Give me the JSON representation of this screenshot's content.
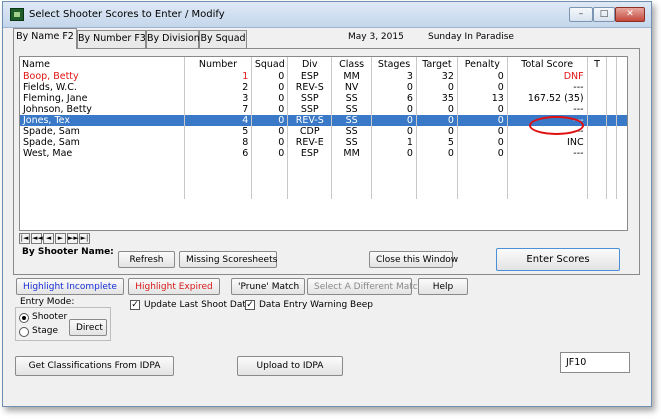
{
  "window": {
    "title": "Select Shooter Scores to Enter / Modify",
    "controls": {
      "minimize": "–",
      "maximize": "□",
      "close": "✕"
    }
  },
  "tabs": [
    {
      "label": "By Name F2",
      "active": true
    },
    {
      "label": "By Number F3",
      "active": false
    },
    {
      "label": "By Division",
      "active": false
    },
    {
      "label": "By Squad",
      "active": false
    }
  ],
  "header_info": {
    "date": "May  3, 2015",
    "match_name": "Sunday In Paradise"
  },
  "grid": {
    "columns": [
      "Name",
      "Number",
      "Squad",
      "Div",
      "Class",
      "Stages",
      "Target",
      "Penalty",
      "Total Score",
      "T"
    ],
    "rows": [
      {
        "name": "Boop, Betty",
        "number": "1",
        "squad": "0",
        "div": "ESP",
        "class": "MM",
        "stages": "3",
        "target": "32",
        "penalty": "0",
        "total": "DNF",
        "t": ""
      },
      {
        "name": "Fields, W.C.",
        "number": "2",
        "squad": "0",
        "div": "REV-S",
        "class": "NV",
        "stages": "0",
        "target": "0",
        "penalty": "0",
        "total": "---",
        "t": ""
      },
      {
        "name": "Fleming, Jane",
        "number": "3",
        "squad": "0",
        "div": "SSP",
        "class": "SS",
        "stages": "6",
        "target": "35",
        "penalty": "13",
        "total": "167.52 (35)",
        "t": ""
      },
      {
        "name": "Johnson, Betty",
        "number": "7",
        "squad": "0",
        "div": "SSP",
        "class": "SS",
        "stages": "0",
        "target": "0",
        "penalty": "0",
        "total": "---",
        "t": ""
      },
      {
        "name": "Jones, Tex",
        "number": "4",
        "squad": "0",
        "div": "REV-S",
        "class": "SS",
        "stages": "0",
        "target": "0",
        "penalty": "0",
        "total": "---",
        "t": ""
      },
      {
        "name": "Spade, Sam",
        "number": "5",
        "squad": "0",
        "div": "CDP",
        "class": "SS",
        "stages": "0",
        "target": "0",
        "penalty": "0",
        "total": "---",
        "t": ""
      },
      {
        "name": "Spade, Sam",
        "number": "8",
        "squad": "0",
        "div": "REV-E",
        "class": "SS",
        "stages": "1",
        "target": "5",
        "penalty": "0",
        "total": "INC",
        "t": ""
      },
      {
        "name": "West, Mae",
        "number": "6",
        "squad": "0",
        "div": "ESP",
        "class": "MM",
        "stages": "0",
        "target": "0",
        "penalty": "0",
        "total": "---",
        "t": ""
      }
    ],
    "nav_glyphs": [
      "|◄",
      "◄◄",
      "◄",
      "►",
      "►►",
      "►|"
    ]
  },
  "panel": {
    "by_shooter_label": "By Shooter Name:",
    "refresh": "Refresh",
    "missing": "Missing Scoresheets",
    "close_window": "Close this Window",
    "enter_scores": "Enter Scores"
  },
  "actions": {
    "highlight_incomplete": "Highlight Incomplete",
    "highlight_expired": "Highlight Expired",
    "prune": "'Prune' Match",
    "select_match": "Select A Different  Match",
    "help": "Help"
  },
  "entry_mode": {
    "label": "Entry Mode:",
    "shooter": "Shooter",
    "stage": "Stage",
    "direct": "Direct"
  },
  "options": {
    "update_last": "Update Last Shoot Date",
    "warning_beep": "Data Entry Warning Beep",
    "check": "✓"
  },
  "bottom": {
    "get_class": "Get Classifications From IDPA",
    "upload": "Upload to IDPA",
    "code": "JF10"
  },
  "colors": {
    "selected": "#3a79c7",
    "alert": "#e01414"
  }
}
